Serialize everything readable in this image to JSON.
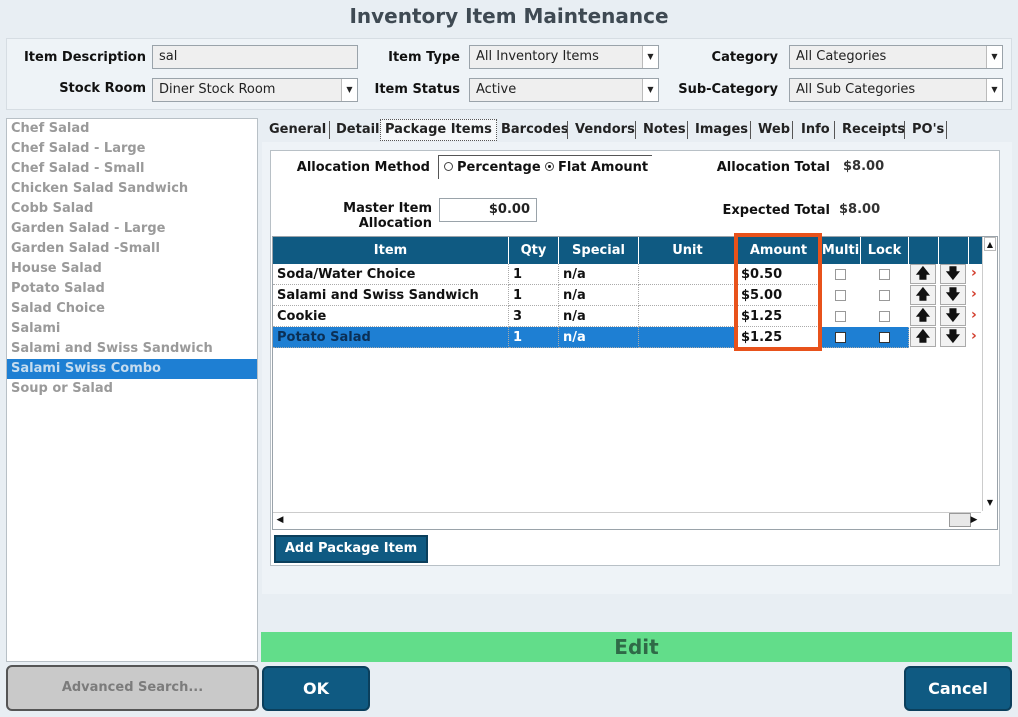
{
  "window": {
    "title": "Inventory Item Maintenance"
  },
  "filters": {
    "item_description_label": "Item Description",
    "item_description_value": "sal",
    "stock_room_label": "Stock Room",
    "stock_room_value": "Diner Stock Room",
    "item_type_label": "Item Type",
    "item_type_value": "All Inventory Items",
    "item_status_label": "Item Status",
    "item_status_value": "Active",
    "category_label": "Category",
    "category_value": "All Categories",
    "subcategory_label": "Sub-Category",
    "subcategory_value": "All Sub Categories"
  },
  "item_list": [
    "Chef Salad",
    "Chef Salad - Large",
    "Chef Salad - Small",
    "Chicken Salad Sandwich",
    "Cobb Salad",
    "Garden Salad - Large",
    "Garden Salad -Small",
    "House Salad",
    "Potato Salad",
    "Salad Choice",
    "Salami",
    "Salami and Swiss Sandwich",
    "Salami Swiss Combo",
    "Soup or Salad"
  ],
  "selected_item": "Salami Swiss Combo",
  "tabs": [
    "General",
    "Detail",
    "Package Items",
    "Barcodes",
    "Vendors",
    "Notes",
    "Images",
    "Web",
    "Info",
    "Receipts",
    "PO's"
  ],
  "active_tab": "Package Items",
  "package": {
    "allocation_method_label": "Allocation Method",
    "option_percentage": "Percentage",
    "option_flat": "Flat Amount",
    "allocation_total_label": "Allocation Total",
    "allocation_total_value": "$8.00",
    "master_allocation_label": "Master Item Allocation",
    "master_allocation_value": "$0.00",
    "expected_total_label": "Expected Total",
    "expected_total_value": "$8.00"
  },
  "grid": {
    "headers": [
      "Item",
      "Qty",
      "Special",
      "Unit",
      "Amount",
      "Multi",
      "Lock"
    ],
    "rows": [
      {
        "item": "Soda/Water Choice",
        "qty": "1",
        "special": "n/a",
        "unit": "",
        "amount": "$0.50"
      },
      {
        "item": "Salami and Swiss Sandwich",
        "qty": "1",
        "special": "n/a",
        "unit": "",
        "amount": "$5.00"
      },
      {
        "item": "Cookie",
        "qty": "3",
        "special": "n/a",
        "unit": "",
        "amount": "$1.25"
      },
      {
        "item": "Potato Salad",
        "qty": "1",
        "special": "n/a",
        "unit": "",
        "amount": "$1.25"
      }
    ],
    "selected_row": 3
  },
  "buttons": {
    "add_package_item": "Add Package Item",
    "edit": "Edit",
    "advanced_search": "Advanced Search...",
    "ok": "OK",
    "cancel": "Cancel"
  },
  "colors": {
    "header_blue": "#0f5a82",
    "selection_blue": "#1e7fd3",
    "edit_green": "#62dd8a",
    "highlight_orange": "#e8521b"
  }
}
